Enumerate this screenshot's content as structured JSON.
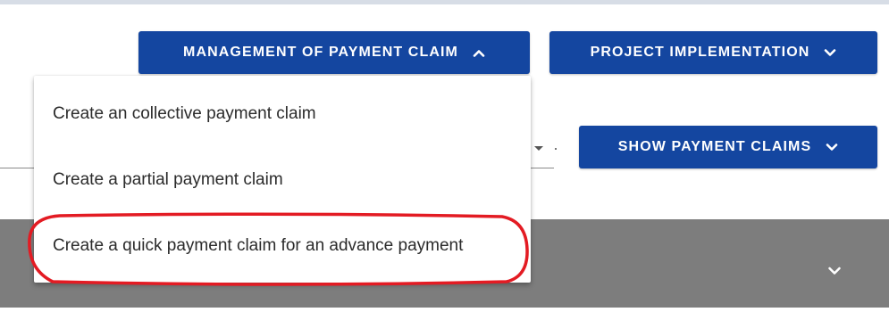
{
  "header": {
    "management_button": {
      "label": "MANAGEMENT OF PAYMENT CLAIM",
      "icon": "chevron-up-icon"
    },
    "project_button": {
      "label": "PROJECT IMPLEMENTATION",
      "icon": "chevron-down-icon"
    }
  },
  "toolbar": {
    "show_claims_button": {
      "label": "SHOW PAYMENT CLAIMS",
      "icon": "chevron-down-icon"
    }
  },
  "dropdown": {
    "items": [
      {
        "label": "Create an collective payment claim"
      },
      {
        "label": "Create a partial payment claim"
      },
      {
        "label": "Create a quick payment claim for an advance payment"
      }
    ]
  },
  "panel": {
    "icon": "chevron-down-icon"
  },
  "annotation": {
    "shape": "red-ellipse",
    "target": "dropdown item 3"
  },
  "colors": {
    "button_bg": "#1446a0",
    "button_text": "#ffffff",
    "panel_bg": "#7d7d7d",
    "annotation": "#e31b23",
    "menu_text": "#2b2b2b"
  }
}
